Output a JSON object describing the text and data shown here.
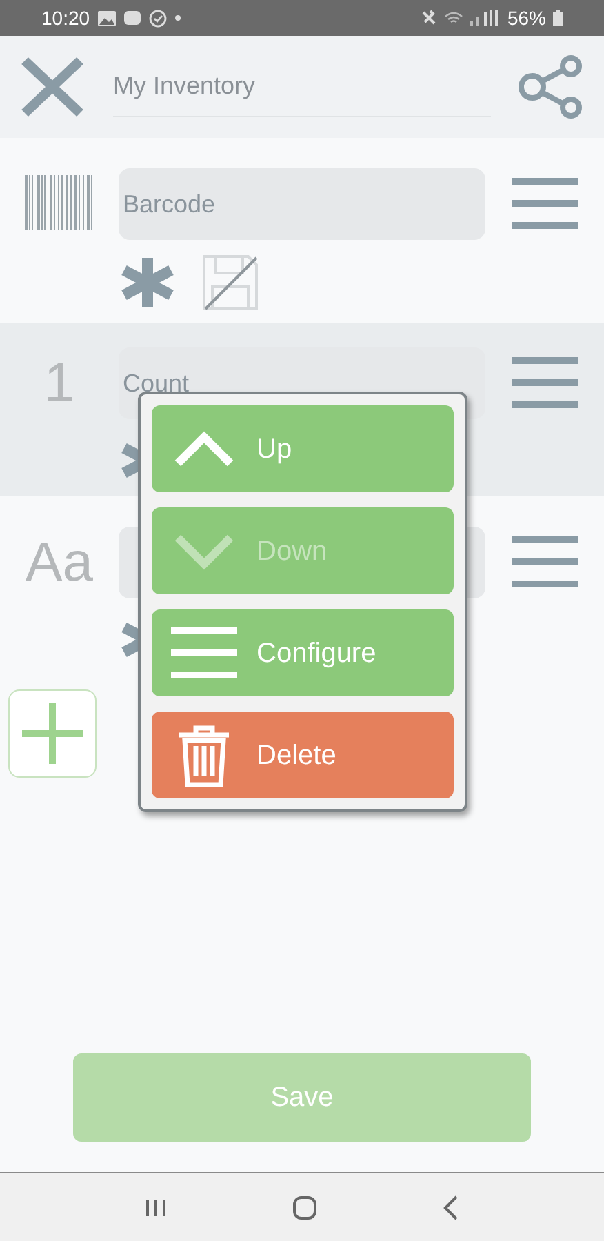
{
  "status_bar": {
    "time": "10:20",
    "battery": "56%"
  },
  "header": {
    "title": "My Inventory"
  },
  "fields": [
    {
      "kind": "barcode",
      "value": "Barcode",
      "selected": false,
      "required": true,
      "save_disabled": true
    },
    {
      "kind": "number",
      "icon_text": "1",
      "value": "Count",
      "selected": true,
      "required": true
    },
    {
      "kind": "text",
      "icon_text": "Aa",
      "selected": false,
      "required": true
    }
  ],
  "popup_menu": [
    {
      "kind": "up",
      "label": "Up",
      "disabled": false
    },
    {
      "kind": "down",
      "label": "Down",
      "disabled": true
    },
    {
      "kind": "configure",
      "label": "Configure",
      "disabled": false
    },
    {
      "kind": "delete",
      "label": "Delete",
      "disabled": false
    }
  ],
  "save_button": {
    "label": "Save",
    "disabled": true
  }
}
